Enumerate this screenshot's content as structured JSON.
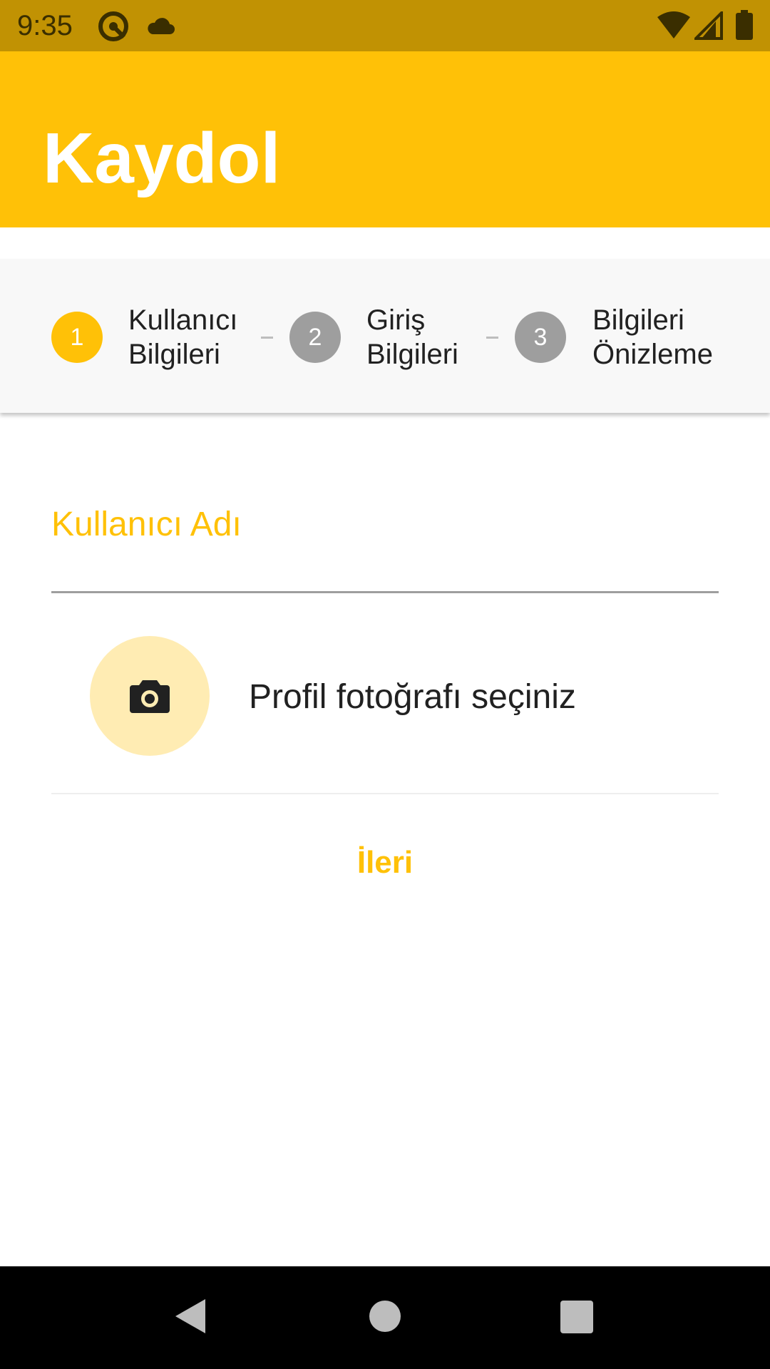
{
  "status_bar": {
    "time": "9:35",
    "icons": [
      "at-sign-icon",
      "cloud-icon",
      "wifi-icon",
      "signal-icon",
      "battery-icon"
    ]
  },
  "app_bar": {
    "title": "Kaydol"
  },
  "colors": {
    "primary": "#ffc107",
    "status_bar": "#c19203",
    "step_inactive": "#9e9e9e",
    "avatar_bg": "#ffecb3"
  },
  "stepper": {
    "steps": [
      {
        "number": "1",
        "line1": "Kullanıcı",
        "line2": "Bilgileri",
        "state": "active"
      },
      {
        "number": "2",
        "line1": "Giriş",
        "line2": "Bilgileri",
        "state": "inactive"
      },
      {
        "number": "3",
        "line1": "Bilgileri",
        "line2": "Önizleme",
        "state": "inactive"
      }
    ]
  },
  "form": {
    "username_label": "Kullanıcı Adı",
    "username_value": "",
    "photo_prompt": "Profil fotoğrafı seçiniz",
    "next_label": "İleri"
  },
  "nav_bar": {
    "icons": [
      "back-icon",
      "home-icon",
      "recents-icon"
    ]
  }
}
